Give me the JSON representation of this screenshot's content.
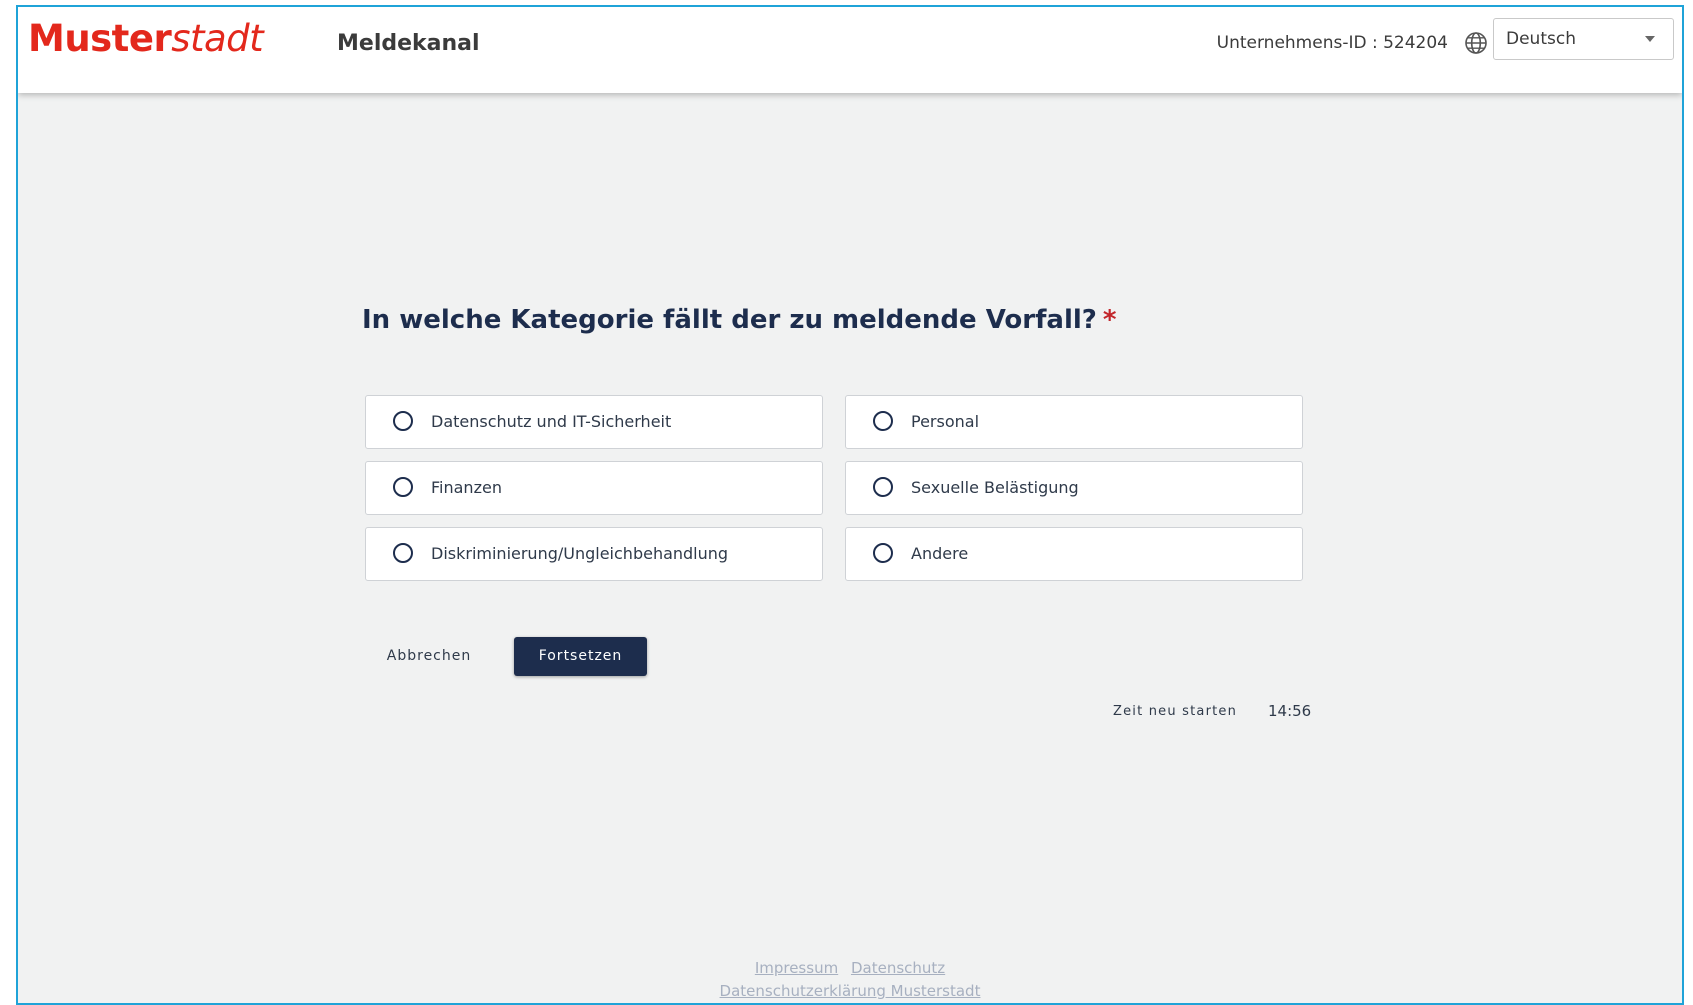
{
  "header": {
    "logo_bold": "Muster",
    "logo_italic": "stadt",
    "title": "Meldekanal",
    "company_id": "Unternehmens-ID : 524204",
    "language": "Deutsch"
  },
  "form": {
    "question": "In welche Kategorie fällt der zu meldende Vorfall?",
    "required_mark": "*",
    "options": [
      {
        "label": "Datenschutz und IT-Sicherheit"
      },
      {
        "label": "Personal"
      },
      {
        "label": "Finanzen"
      },
      {
        "label": "Sexuelle Belästigung"
      },
      {
        "label": "Diskriminierung/Ungleichbehandlung"
      },
      {
        "label": "Andere"
      }
    ],
    "cancel_label": "Abbrechen",
    "continue_label": "Fortsetzen"
  },
  "session": {
    "restart_label": "Zeit neu starten",
    "timer": "14:56"
  },
  "footer": {
    "impressum": "Impressum",
    "datenschutz": "Datenschutz",
    "privacy_statement": "Datenschutzerklärung Musterstadt"
  },
  "colors": {
    "brand_red": "#e3281c",
    "navy": "#1d2d4d",
    "required_red": "#c2262b",
    "page_background": "#f1f2f2",
    "frame_border": "#1fa3d8"
  },
  "icons": {
    "language": "globe-icon",
    "dropdown": "chevron-down-icon"
  }
}
